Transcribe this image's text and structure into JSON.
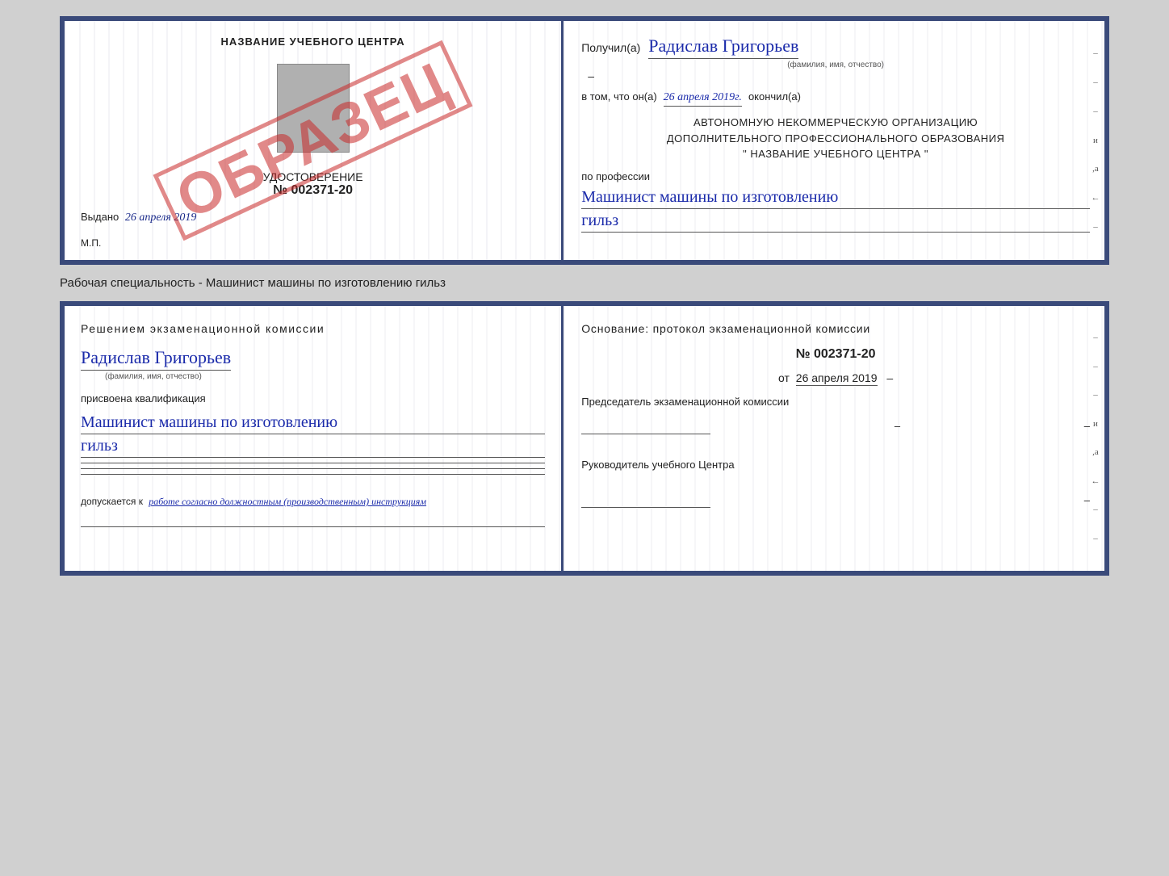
{
  "page": {
    "background_color": "#d0d0d0"
  },
  "top_doc": {
    "left": {
      "title": "НАЗВАНИЕ УЧЕБНОГО ЦЕНТРА",
      "stamp": "ОБРАЗЕЦ",
      "cert_label": "УДОСТОВЕРЕНИЕ",
      "cert_number": "№ 002371-20",
      "issued_label": "Выдано",
      "issued_date": "26 апреля 2019",
      "mp_label": "М.П."
    },
    "right": {
      "received_label": "Получил(а)",
      "recipient_name": "Радислав Григорьев",
      "name_subtitle": "(фамилия, имя, отчество)",
      "completed_prefix": "в том, что он(а)",
      "completed_date": "26 апреля 2019г.",
      "completed_suffix": "окончил(а)",
      "org_line1": "АВТОНОМНУЮ НЕКОММЕРЧЕСКУЮ ОРГАНИЗАЦИЮ",
      "org_line2": "ДОПОЛНИТЕЛЬНОГО ПРОФЕССИОНАЛЬНОГО ОБРАЗОВАНИЯ",
      "org_line3": "\" НАЗВАНИЕ УЧЕБНОГО ЦЕНТРА \"",
      "profession_label": "по профессии",
      "profession_line1": "Машинист машины по изготовлению",
      "profession_line2": "гильз"
    }
  },
  "specialty_label": "Рабочая специальность - Машинист машины по изготовлению гильз",
  "bottom_doc": {
    "left": {
      "decision_text": "Решением  экзаменационной  комиссии",
      "person_name": "Радислав Григорьев",
      "name_subtitle": "(фамилия, имя, отчество)",
      "assigned_label": "присвоена квалификация",
      "qualification_line1": "Машинист  машины  по  изготовлению",
      "qualification_line2": "гильз",
      "allowed_prefix": "допускается к",
      "allowed_text": "работе согласно должностным (производственным) инструкциям"
    },
    "right": {
      "basis_text": "Основание: протокол экзаменационной  комиссии",
      "protocol_number": "№  002371-20",
      "protocol_date_prefix": "от",
      "protocol_date": "26 апреля 2019",
      "chairman_title": "Председатель экзаменационной комиссии",
      "head_title": "Руководитель учебного Центра"
    }
  },
  "edge_dashes": [
    "-",
    "–",
    "и",
    ",а",
    "←",
    "–",
    "–",
    "–"
  ],
  "edge_dashes_bottom": [
    "-",
    "–",
    "и",
    ",а",
    "←",
    "–",
    "–",
    "–"
  ]
}
